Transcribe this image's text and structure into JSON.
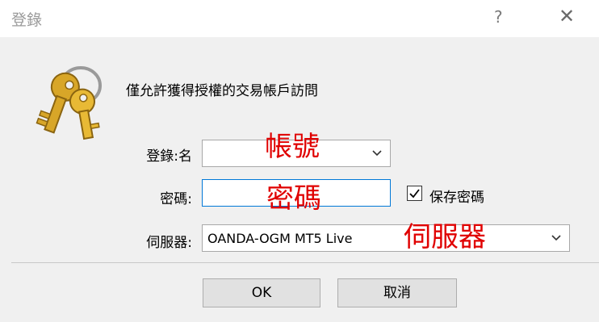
{
  "window": {
    "title": "登錄",
    "help_glyph": "?",
    "close_glyph": "✕"
  },
  "description": "僅允許獲得授權的交易帳戶訪問",
  "form": {
    "login_label": "登錄:名",
    "login_value": "",
    "password_label": "密碼:",
    "password_value": "",
    "save_password_label": "保存密碼",
    "save_password_checked": true,
    "server_label": "伺服器:",
    "server_value": "OANDA-OGM MT5 Live"
  },
  "annotations": {
    "account": "帳號",
    "password": "密碼",
    "server": "伺服器"
  },
  "buttons": {
    "ok": "OK",
    "cancel": "取消"
  },
  "icons": {
    "dialog_icon": "keys-icon",
    "dropdown": "chevron-down-icon",
    "check": "checkmark-icon"
  },
  "colors": {
    "annotation": "#e00000",
    "focus_border": "#0078d7",
    "key_gold": "#d8a628"
  }
}
